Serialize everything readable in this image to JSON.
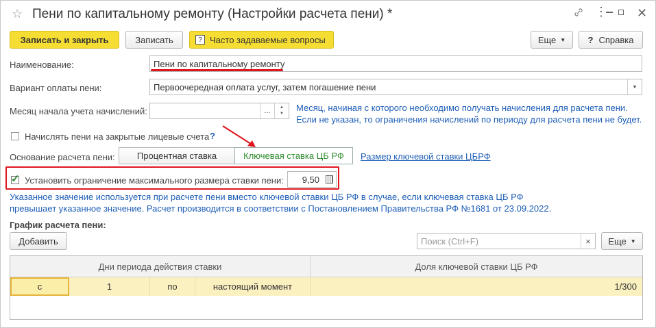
{
  "window": {
    "title": "Пени по капитальному ремонту (Настройки расчета пени) *",
    "link_icon": "link-icon",
    "more_icon": "more-icon",
    "minimize_icon": "minimize-icon",
    "maximize_icon": "maximize-icon",
    "close_icon": "close-icon"
  },
  "toolbar": {
    "save_close": "Записать и закрыть",
    "save": "Записать",
    "faq": "Часто задаваемые вопросы",
    "faq_icon": "?",
    "more": "Еще",
    "help_icon": "?",
    "help": "Справка"
  },
  "form": {
    "name_label": "Наименование:",
    "name_value": "Пени по капитальному ремонту",
    "payment_label": "Вариант оплаты пени:",
    "payment_value": "Первоочередная оплата услуг, затем погашение пени",
    "month_label": "Месяц начала учета начислений:",
    "month_value": "",
    "month_btn": "...",
    "month_hint_1": "Месяц, начиная с которого необходимо получать начисления для расчета пени.",
    "month_hint_2": "Если не указан, то ограничения начислений по периоду для расчета пени не будет.",
    "closed_accounts_label": "Начислять пени на закрытые лицевые счета",
    "closed_accounts_checked": false,
    "question_mark": "?",
    "basis_label": "Основание расчета пени:",
    "basis_option_1": "Процентная ставка",
    "basis_option_2": "Ключевая ставка ЦБ РФ",
    "basis_selected": "Ключевая ставка ЦБ РФ",
    "key_rate_link": "Размер ключевой ставки ЦБРФ",
    "limit_label": "Установить ограничение максимального размера ставки пени:",
    "limit_checked": true,
    "limit_value": "9,50",
    "limit_hint_1": "Указанное значение используется при расчете пени вместо ключевой ставки ЦБ РФ в случае, если ключевая ставка ЦБ РФ",
    "limit_hint_2": "превышает указанное значение. Расчет производится в соответствии с Постановлением Правительства РФ №1681 от 23.09.2022."
  },
  "schedule": {
    "title": "График расчета пени:",
    "add": "Добавить",
    "search_placeholder": "Поиск (Ctrl+F)",
    "clear": "×",
    "more": "Еще",
    "columns": [
      "Дни периода действия ставки",
      "Доля ключевой ставки ЦБ РФ"
    ],
    "rows": [
      {
        "from_label": "с",
        "from_value": "1",
        "to_label": "по",
        "to_value": "настоящий момент",
        "share": "1/300"
      }
    ]
  },
  "colors": {
    "accent_yellow": "#f5dd33",
    "hint_blue": "#1f5fb7",
    "highlight_red": "#e0161f",
    "selected_green": "#2e8b2e",
    "row_yellow": "#fbf0c0"
  }
}
